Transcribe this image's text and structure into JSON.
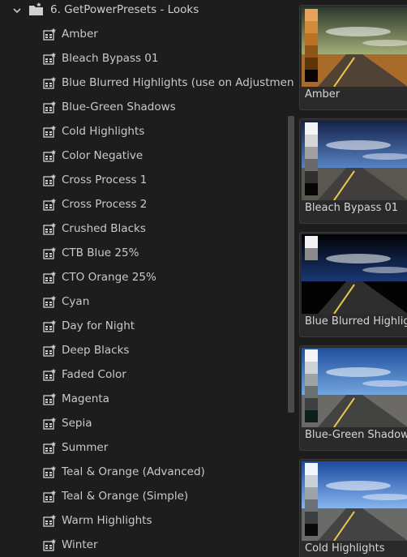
{
  "folder": {
    "label": "6. GetPowerPresets - Looks"
  },
  "presets": [
    "Amber",
    "Bleach Bypass 01",
    "Blue Blurred Highlights (use on Adjustment La",
    "Blue-Green Shadows",
    "Cold Highlights",
    "Color Negative",
    "Cross Process 1",
    "Cross Process 2",
    "Crushed Blacks",
    "CTB Blue 25%",
    "CTO Orange 25%",
    "Cyan",
    "Day for Night",
    "Deep Blacks",
    "Faded Color",
    "Magenta",
    "Sepia",
    "Summer",
    "Teal & Orange (Advanced)",
    "Teal & Orange (Simple)",
    "Warm Highlights",
    "Winter"
  ],
  "thumbnails": [
    {
      "caption": "Amber",
      "swatches": [
        "#e8a35a",
        "#d48a3d",
        "#b97325",
        "#8f5516",
        "#5e3409",
        "#0a0502"
      ],
      "sky_top": "#2c3a2a",
      "sky_mid": "#a8b07a",
      "ground": "#a86b2a"
    },
    {
      "caption": "Bleach Bypass 01",
      "swatches": [
        "#f4f4f4",
        "#d6d6d6",
        "#a0a0a0",
        "#6a6a6a",
        "#303030",
        "#060606"
      ],
      "sky_top": "#14224a",
      "sky_mid": "#5a86c8",
      "ground": "#5a5650"
    },
    {
      "caption": "Blue Blurred Highlig",
      "swatches": [
        "#f2f2f2",
        "#8a8a8a"
      ],
      "sky_top": "#010205",
      "sky_mid": "#1a3a78",
      "ground": "#030304"
    },
    {
      "caption": "Blue-Green Shadow",
      "swatches": [
        "#f2f4f6",
        "#cfd3d6",
        "#9ea4a6",
        "#6b7070",
        "#3d4240",
        "#0e1e1c"
      ],
      "sky_top": "#1f4f9e",
      "sky_mid": "#77a8e0",
      "ground": "#6b6a66"
    },
    {
      "caption": "Cold Highlights",
      "swatches": [
        "#eef6ff",
        "#c8d0d8",
        "#9ca3aa",
        "#6c7178",
        "#3b3e42",
        "#0a0a0b"
      ],
      "sky_top": "#1c4aa0",
      "sky_mid": "#8ab8f0",
      "ground": "#6a6a68"
    }
  ]
}
